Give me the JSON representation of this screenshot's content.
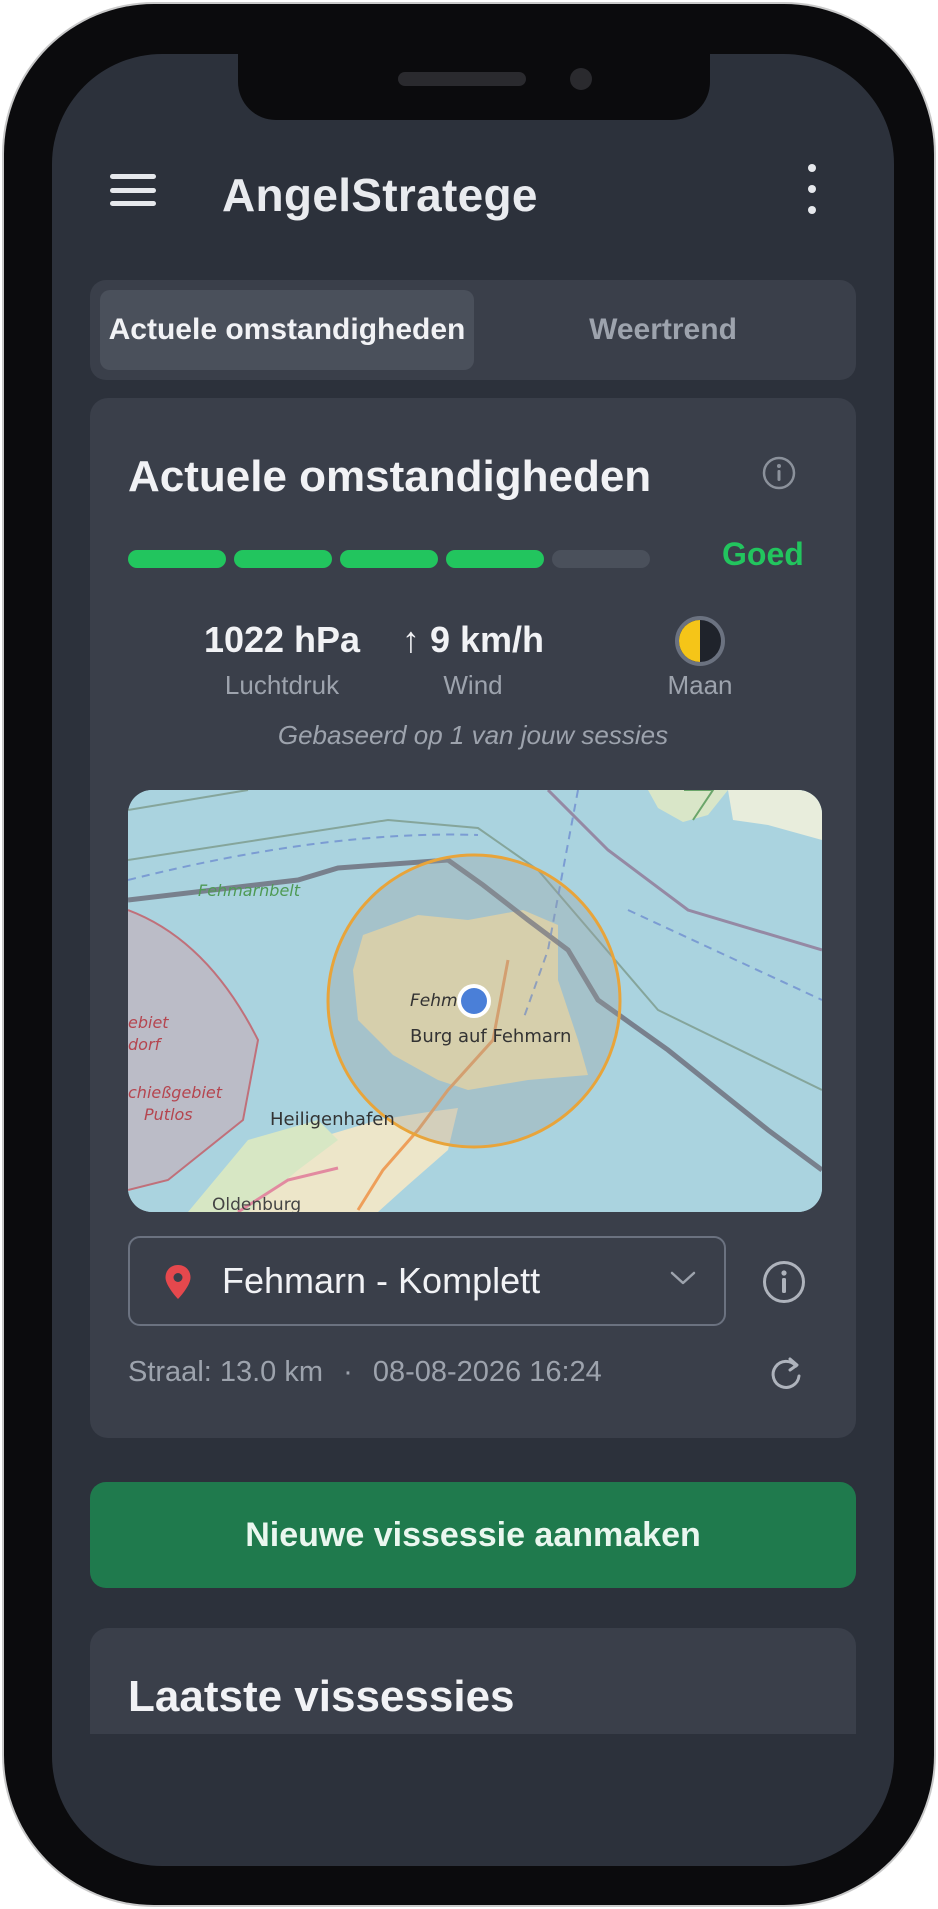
{
  "app": {
    "title": "AngelStratege"
  },
  "tabs": [
    {
      "label": "Actuele omstandigheden",
      "active": true
    },
    {
      "label": "Weertrend",
      "active": false
    }
  ],
  "conditions": {
    "title": "Actuele omstandigheden",
    "rating_label": "Goed",
    "rating_level": 4,
    "rating_max": 5,
    "stats": {
      "pressure": {
        "value": "1022 hPa",
        "label": "Luchtdruk"
      },
      "wind": {
        "arrow": "↑",
        "value": "9 km/h",
        "label": "Wind"
      },
      "moon": {
        "label": "Maan",
        "phase": "half"
      }
    },
    "basis_text": "Gebaseerd op 1 van jouw sessies",
    "map": {
      "labels": {
        "strait": "Fehmarnbelt",
        "island_short": "Fehm",
        "town": "Burg auf Fehmarn",
        "town2": "Heiligenhafen",
        "town3": "Oldenburg",
        "zone1a": "ebiet",
        "zone1b": "dorf",
        "zone2a": "chießgebiet",
        "zone2b": "Putlos"
      }
    },
    "spot": {
      "name": "Fehmarn - Komplett"
    },
    "meta": {
      "radius": "Straal: 13.0 km",
      "separator": "·",
      "datetime": "08-08-2026 16:24"
    }
  },
  "actions": {
    "new_session": "Nieuwe vissessie aanmaken"
  },
  "latest": {
    "title": "Laatste vissessies"
  },
  "colors": {
    "background": "#2c313b",
    "card": "#3a3f4a",
    "accent_green": "#22c55e",
    "button_green": "#1f7a4d",
    "pin_red": "#e5484d",
    "location_blue": "#4a7fd8"
  },
  "icons": [
    "menu-icon",
    "more-vert-icon",
    "info-icon",
    "moon-icon",
    "location-pin-icon",
    "chevron-down-icon",
    "refresh-icon"
  ]
}
